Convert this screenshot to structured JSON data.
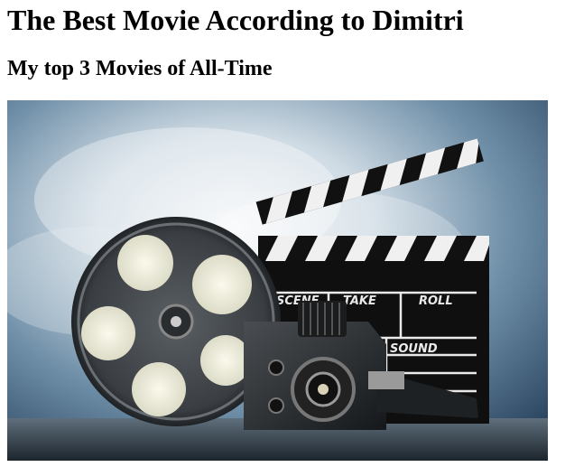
{
  "page": {
    "title": "The Best Movie According to Dimitri",
    "subtitle": "My top 3 Movies of All-Time"
  },
  "hero_image": {
    "icon": "film-equipment-photo",
    "clapperboard_labels": {
      "scene": "SCENE",
      "take": "TAKE",
      "roll": "ROLL",
      "sound": "SOUND"
    }
  }
}
